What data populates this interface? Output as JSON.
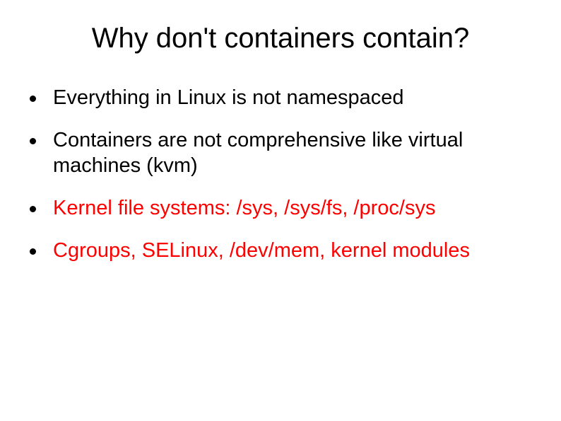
{
  "slide": {
    "title": "Why don't containers contain?",
    "bullets": [
      {
        "text": "Everything in Linux is not namespaced",
        "color": "black"
      },
      {
        "text": "Containers are not comprehensive like virtual machines (kvm)",
        "color": "black"
      },
      {
        "text": "Kernel file systems: /sys, /sys/fs, /proc/sys",
        "color": "red"
      },
      {
        "text": "Cgroups, SELinux, /dev/mem, kernel modules",
        "color": "red"
      }
    ]
  }
}
